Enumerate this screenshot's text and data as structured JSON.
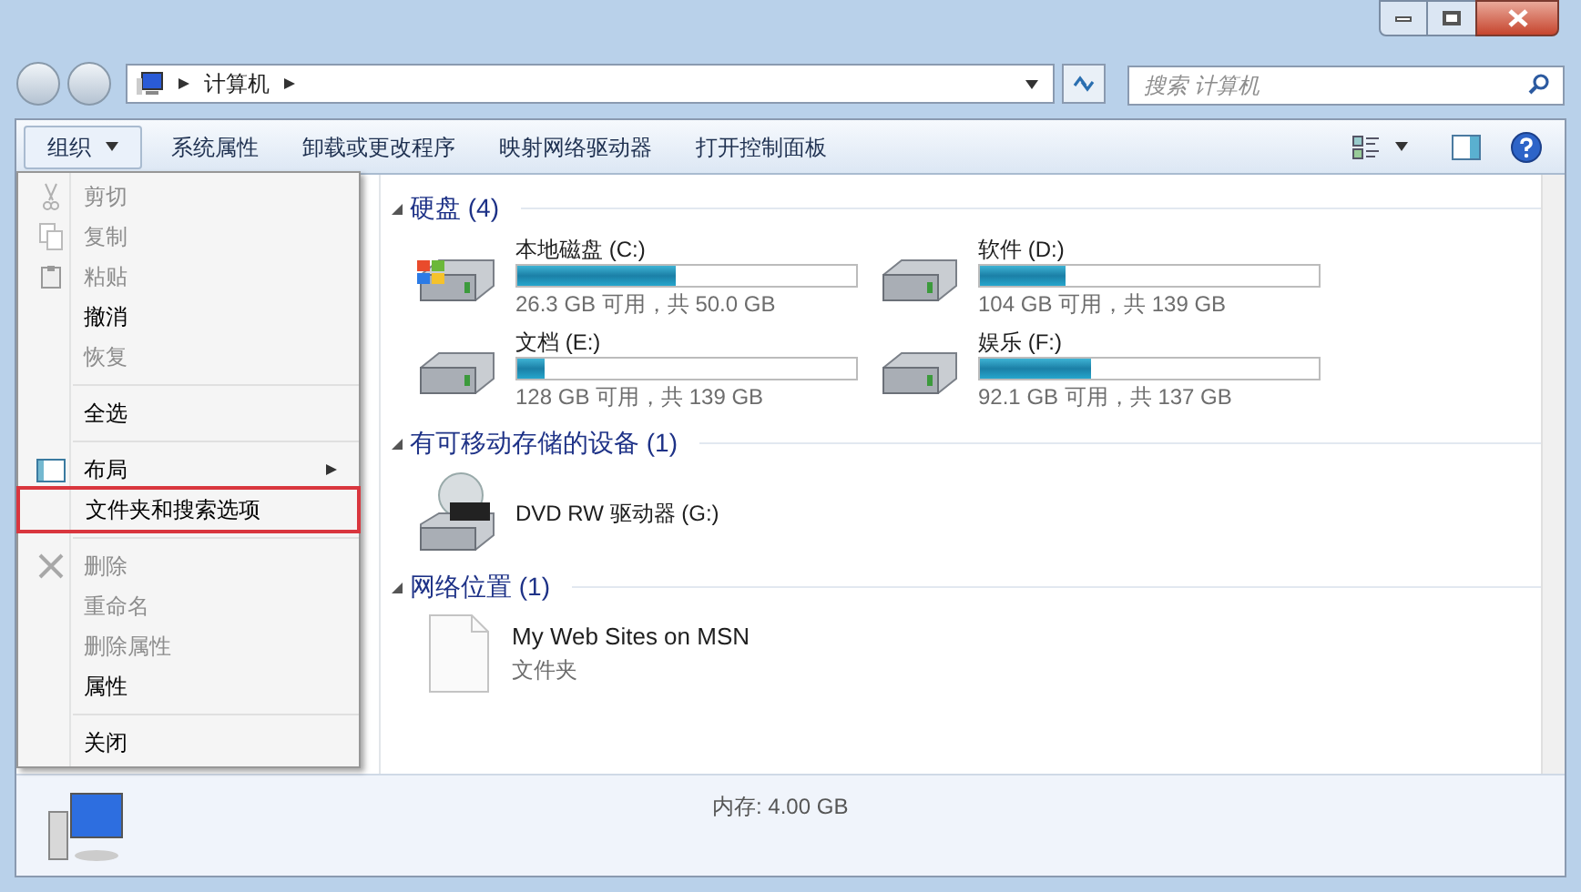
{
  "address": {
    "crumbs": [
      "计算机"
    ]
  },
  "search": {
    "placeholder": "搜索 计算机"
  },
  "toolbar": {
    "items": [
      {
        "label": "组织",
        "dropdown": true
      },
      {
        "label": "系统属性",
        "dropdown": false
      },
      {
        "label": "卸载或更改程序",
        "dropdown": false
      },
      {
        "label": "映射网络驱动器",
        "dropdown": false
      },
      {
        "label": "打开控制面板",
        "dropdown": false
      }
    ]
  },
  "menu": {
    "items": [
      {
        "kind": "item",
        "label": "剪切",
        "disabled": true,
        "highlighted": false,
        "submenu": false
      },
      {
        "kind": "item",
        "label": "复制",
        "disabled": true,
        "highlighted": false,
        "submenu": false
      },
      {
        "kind": "item",
        "label": "粘贴",
        "disabled": true,
        "highlighted": false,
        "submenu": false
      },
      {
        "kind": "item",
        "label": "撤消",
        "disabled": false,
        "highlighted": false,
        "submenu": false
      },
      {
        "kind": "item",
        "label": "恢复",
        "disabled": true,
        "highlighted": false,
        "submenu": false
      },
      {
        "kind": "separator"
      },
      {
        "kind": "item",
        "label": "全选",
        "disabled": false,
        "highlighted": false,
        "submenu": false
      },
      {
        "kind": "separator"
      },
      {
        "kind": "item",
        "label": "布局",
        "disabled": false,
        "highlighted": false,
        "submenu": true
      },
      {
        "kind": "item",
        "label": "文件夹和搜索选项",
        "disabled": false,
        "highlighted": true,
        "submenu": false
      },
      {
        "kind": "separator"
      },
      {
        "kind": "item",
        "label": "删除",
        "disabled": true,
        "highlighted": false,
        "submenu": false
      },
      {
        "kind": "item",
        "label": "重命名",
        "disabled": true,
        "highlighted": false,
        "submenu": false
      },
      {
        "kind": "item",
        "label": "删除属性",
        "disabled": true,
        "highlighted": false,
        "submenu": false
      },
      {
        "kind": "item",
        "label": "属性",
        "disabled": false,
        "highlighted": false,
        "submenu": false
      },
      {
        "kind": "separator"
      },
      {
        "kind": "item",
        "label": "关闭",
        "disabled": false,
        "highlighted": false,
        "submenu": false
      }
    ]
  },
  "groups": [
    {
      "title": "硬盘 (4)",
      "expanded": true,
      "items": [
        {
          "kind": "system_drive",
          "name": "本地磁盘 (C:)",
          "level": 0.47,
          "reading": "26.3 GB 可用，共 50.0 GB"
        },
        {
          "kind": "drive",
          "name": "软件 (D:)",
          "level": 0.25,
          "reading": "104 GB 可用，共 139 GB"
        },
        {
          "kind": "drive",
          "name": "文档 (E:)",
          "level": 0.08,
          "reading": "128 GB 可用，共 139 GB"
        },
        {
          "kind": "drive",
          "name": "娱乐 (F:)",
          "level": 0.33,
          "reading": "92.1 GB 可用，共 137 GB"
        }
      ]
    },
    {
      "title": "有可移动存储的设备 (1)",
      "expanded": true,
      "items": [
        {
          "kind": "dvd",
          "name": "DVD RW 驱动器 (G:)"
        }
      ]
    },
    {
      "title": "网络位置 (1)",
      "expanded": true,
      "items": [
        {
          "kind": "folder",
          "name": "My Web Sites on MSN",
          "subtitle": "文件夹"
        }
      ]
    }
  ],
  "details": {
    "text": "内存: 4.00 GB"
  }
}
